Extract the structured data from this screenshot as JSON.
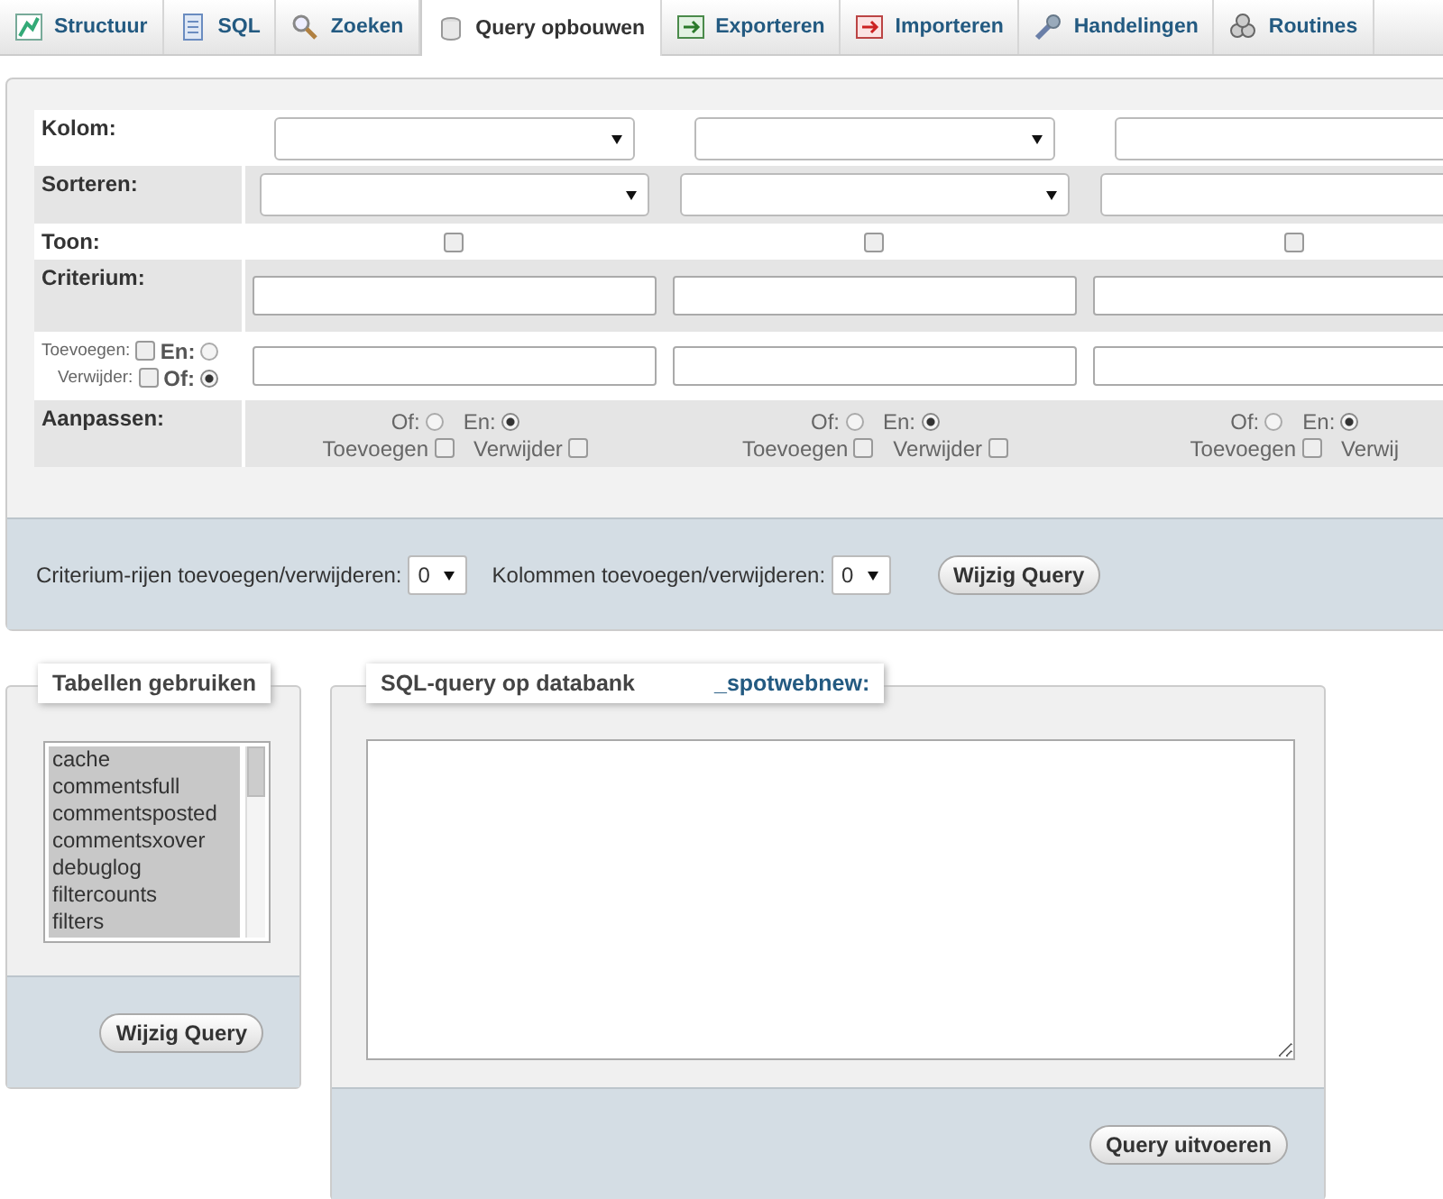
{
  "tabs": [
    {
      "label": "Structuur",
      "selected": false
    },
    {
      "label": "SQL",
      "selected": false
    },
    {
      "label": "Zoeken",
      "selected": false
    },
    {
      "label": "Query opbouwen",
      "selected": true
    },
    {
      "label": "Exporteren",
      "selected": false
    },
    {
      "label": "Importeren",
      "selected": false
    },
    {
      "label": "Handelingen",
      "selected": false
    },
    {
      "label": "Routines",
      "selected": false
    }
  ],
  "grid": {
    "labels": {
      "kolom": "Kolom:",
      "sorteren": "Sorteren:",
      "toon": "Toon:",
      "criterium": "Criterium:",
      "aanpassen": "Aanpassen:"
    },
    "row_control": {
      "toevoegen_label": "Toevoegen:",
      "toevoegen_checked": false,
      "en_label": "En:",
      "en_selected": false,
      "verwijder_label": "Verwijder:",
      "verwijder_checked": false,
      "of_label": "Of:",
      "of_selected": true
    },
    "columns": [
      {
        "toon_checked": false,
        "of_label": "Of:",
        "of_selected": false,
        "en_label": "En:",
        "en_selected": true,
        "toevoegen_label": "Toevoegen",
        "toevoegen_checked": false,
        "verwijder_label": "Verwijder",
        "verwijder_checked": false
      },
      {
        "toon_checked": false,
        "of_label": "Of:",
        "of_selected": false,
        "en_label": "En:",
        "en_selected": true,
        "toevoegen_label": "Toevoegen",
        "toevoegen_checked": false,
        "verwijder_label": "Verwijder",
        "verwijder_checked": false
      },
      {
        "toon_checked": false,
        "of_label": "Of:",
        "of_selected": false,
        "en_label": "En:",
        "en_selected": true,
        "toevoegen_label": "Toevoegen",
        "toevoegen_checked": false,
        "verwijder_label": "Verwij"
      }
    ]
  },
  "footer": {
    "rows_label": "Criterium-rijen toevoegen/verwijderen:",
    "rows_value": "0",
    "cols_label": "Kolommen toevoegen/verwijderen:",
    "cols_value": "0",
    "button": "Wijzig Query"
  },
  "tables_panel": {
    "legend": "Tabellen gebruiken",
    "items": [
      {
        "name": "cache",
        "selected": true
      },
      {
        "name": "commentsfull",
        "selected": true
      },
      {
        "name": "commentsposted",
        "selected": true
      },
      {
        "name": "commentsxover",
        "selected": true
      },
      {
        "name": "debuglog",
        "selected": true
      },
      {
        "name": "filtercounts",
        "selected": true
      },
      {
        "name": "filters",
        "selected": true
      }
    ],
    "button": "Wijzig Query"
  },
  "sql_panel": {
    "legend": "SQL-query op databank",
    "database": "_spotwebnew:",
    "button": "Query uitvoeren"
  }
}
